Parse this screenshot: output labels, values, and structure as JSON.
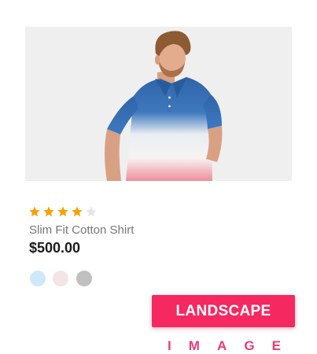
{
  "product": {
    "image_alt": "Man wearing a blue to white to pink ombre polo shirt",
    "rating": 4,
    "rating_max": 5,
    "title": "Slim Fit Cotton Shirt",
    "price": "$500.00",
    "swatches": [
      {
        "name": "light-blue",
        "color": "#cfe7fb"
      },
      {
        "name": "light-pink",
        "color": "#f3e4e6"
      },
      {
        "name": "gray",
        "color": "#c0c0c0"
      }
    ]
  },
  "badge": {
    "label": "LANDSCAPE",
    "caption_letters": [
      "I",
      "M",
      "A",
      "G",
      "E"
    ]
  },
  "colors": {
    "star_filled": "#f6a100",
    "star_empty": "#e5e5e5",
    "accent": "#f5285f",
    "caption": "#ec3c74"
  }
}
